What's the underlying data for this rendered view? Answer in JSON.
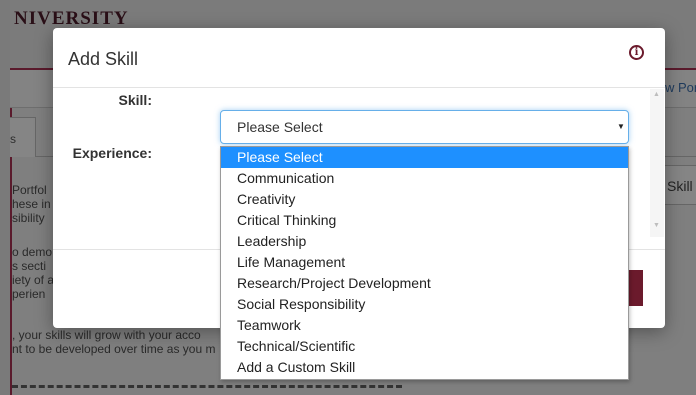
{
  "background": {
    "university_fragment": "NIVERSITY",
    "portfolio_link_fragment": "w Por",
    "tab_fragment": "s",
    "skills_tab_fragment": "Skill",
    "text_fragments": [
      "Portfol",
      "hese in",
      "sibility",
      "o demo",
      "s secti",
      "iety of a",
      "perien",
      ", your skills will grow with your acco",
      "nt to be developed over time as you m"
    ]
  },
  "modal": {
    "title": "Add Skill",
    "info_icon": "info-icon",
    "skill_label": "Skill:",
    "experience_label": "Experience:",
    "skill_select": {
      "selected_value": "Please Select",
      "options": [
        "Please Select",
        "Communication",
        "Creativity",
        "Critical Thinking",
        "Leadership",
        "Life Management",
        "Research/Project Development",
        "Social Responsibility",
        "Teamwork",
        "Technical/Scientific",
        "Add a Custom Skill"
      ]
    }
  },
  "colors": {
    "brand": "#6b1a2c",
    "highlight": "#1e90ff",
    "focus_border": "#66afe9"
  }
}
